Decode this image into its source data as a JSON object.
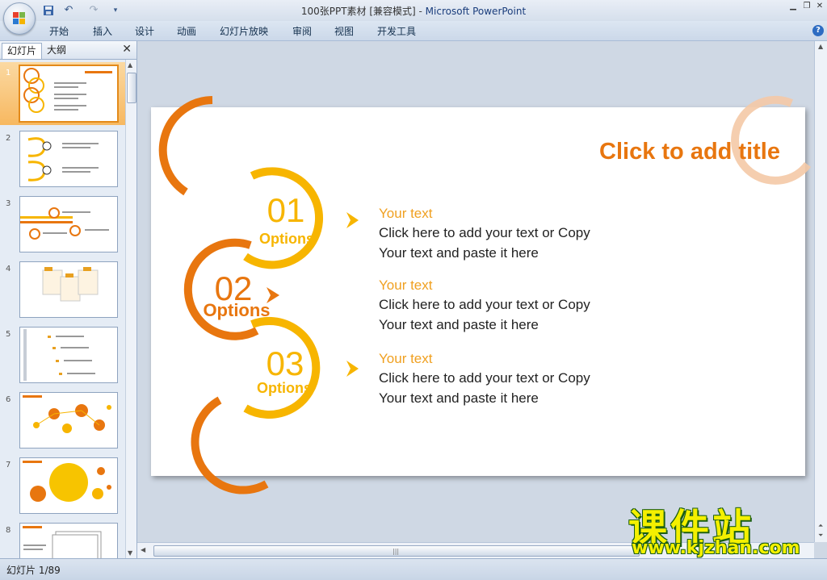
{
  "window": {
    "title_prefix": "100张PPT素材 [兼容模式]",
    "title_sep": " - ",
    "title_app": "Microsoft PowerPoint"
  },
  "qat": {
    "save_icon": "save-icon",
    "undo_icon": "undo-icon",
    "redo_icon": "redo-icon"
  },
  "ribbon": {
    "tabs": [
      "开始",
      "插入",
      "设计",
      "动画",
      "幻灯片放映",
      "审阅",
      "视图",
      "开发工具"
    ],
    "help": "?"
  },
  "pane": {
    "tab_slides": "幻灯片",
    "tab_outline": "大纲",
    "close": "✕",
    "thumb_numbers": [
      "1",
      "2",
      "3",
      "4",
      "5",
      "6",
      "7",
      "8"
    ]
  },
  "slide": {
    "title": "Click to add title",
    "items": [
      {
        "number": "01",
        "label": "Options",
        "heading": "Your text",
        "line1": "Click here to add your text or Copy",
        "line2": "Your text and paste it here"
      },
      {
        "number": "02",
        "label": "Options",
        "heading": "Your text",
        "line1": "Click here to add your text or Copy",
        "line2": "Your text and paste it here"
      },
      {
        "number": "03",
        "label": "Options",
        "heading": "Your text",
        "line1": "Click here to add your text or Copy",
        "line2": "Your text and paste it here"
      }
    ],
    "colors": {
      "orange": "#e8760f",
      "yellow": "#f7b500",
      "title": "#e8760f",
      "heading": "#f0a020",
      "body": "#222222"
    }
  },
  "status": {
    "slide_count": "幻灯片 1/89"
  },
  "watermark": {
    "cn": "课件站",
    "url": "www.kjzhan.com"
  }
}
